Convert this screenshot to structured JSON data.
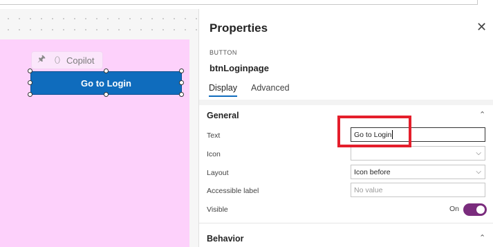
{
  "canvas": {
    "copilot_label": "Copilot",
    "button_label": "Go to Login",
    "screen_color": "#fdd1fb",
    "button_color": "#0f6cbd"
  },
  "properties": {
    "title": "Properties",
    "control_type": "BUTTON",
    "control_name": "btnLoginpage",
    "tabs": [
      {
        "label": "Display",
        "selected": true
      },
      {
        "label": "Advanced",
        "selected": false
      }
    ],
    "sections": {
      "general": "General",
      "behavior": "Behavior"
    },
    "rows": {
      "text": {
        "label": "Text",
        "value": "Go to Login"
      },
      "icon": {
        "label": "Icon",
        "value": ""
      },
      "layout": {
        "label": "Layout",
        "value": "Icon before"
      },
      "accessible_label": {
        "label": "Accessible label",
        "placeholder": "No value"
      },
      "visible": {
        "label": "Visible",
        "state": "On"
      }
    },
    "accent_color": "#7a2c7d",
    "highlight_color": "#e41e2b"
  },
  "icons": {
    "close": "close-icon",
    "pin": "pin-icon",
    "copilot": "copilot-icon",
    "chevron_down": "chevron-down-icon",
    "chevron_up": "chevron-up-icon"
  }
}
